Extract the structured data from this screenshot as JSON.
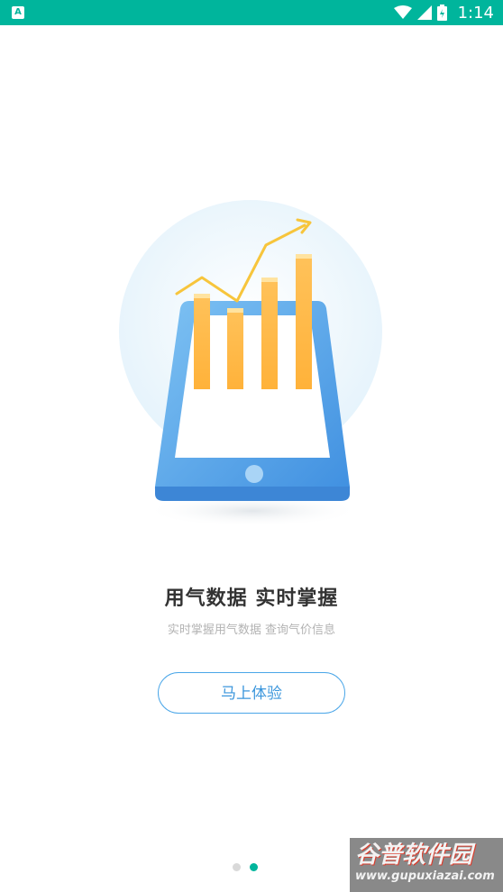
{
  "status_bar": {
    "left_icon": "A",
    "time": "1:14",
    "background": "#00b59c",
    "icons": [
      "wifi-icon",
      "signal-icon",
      "battery-icon"
    ]
  },
  "onboarding": {
    "title": "用气数据  实时掌握",
    "subtitle": "实时掌握用气数据  查询气价信息",
    "cta_label": "马上体验",
    "accent": "#3b96dc",
    "page_indicator": {
      "total": 2,
      "active": 2,
      "active_color": "#00b59c",
      "inactive_color": "#d9d9d9"
    }
  },
  "watermark": {
    "brand": "谷普软件园",
    "url": "www.gupuxiazai.com"
  }
}
